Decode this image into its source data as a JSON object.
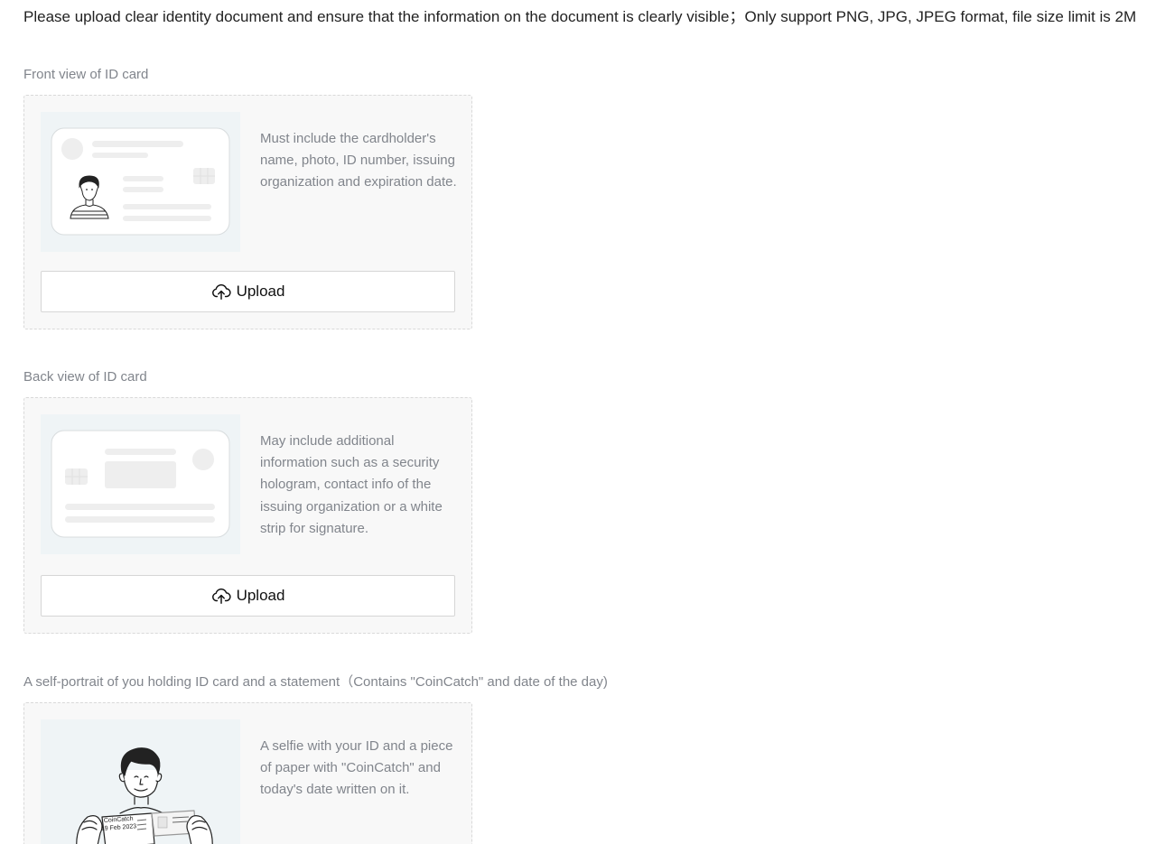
{
  "instructions": "Please upload clear identity document and ensure that the information on the document is clearly visible；Only support PNG, JPG, JPEG format, file size limit is 2M",
  "sections": [
    {
      "label": "Front view of ID card",
      "description": "Must include the cardholder's name, photo, ID number, issuing organization and expiration date.",
      "upload_label": "Upload",
      "upload_icon": "cloud-upload-icon"
    },
    {
      "label": "Back view of ID card",
      "description": "May include additional information such as a security hologram, contact info of the issuing organization or a white strip for signature.",
      "upload_label": "Upload",
      "upload_icon": "cloud-upload-icon"
    },
    {
      "label": "A self-portrait of you holding ID card and a statement（Contains \"CoinCatch\" and date of the day)",
      "description": "A selfie with your ID and a piece of paper with \"CoinCatch\" and today's date written on it.",
      "illustration_note_line1": "CoinCatch",
      "illustration_note_line2": "19 Feb 2023"
    }
  ],
  "colors": {
    "card_background": "#f8f8f8",
    "illustration_background": "#eff4f6",
    "muted_text": "#81858c"
  }
}
